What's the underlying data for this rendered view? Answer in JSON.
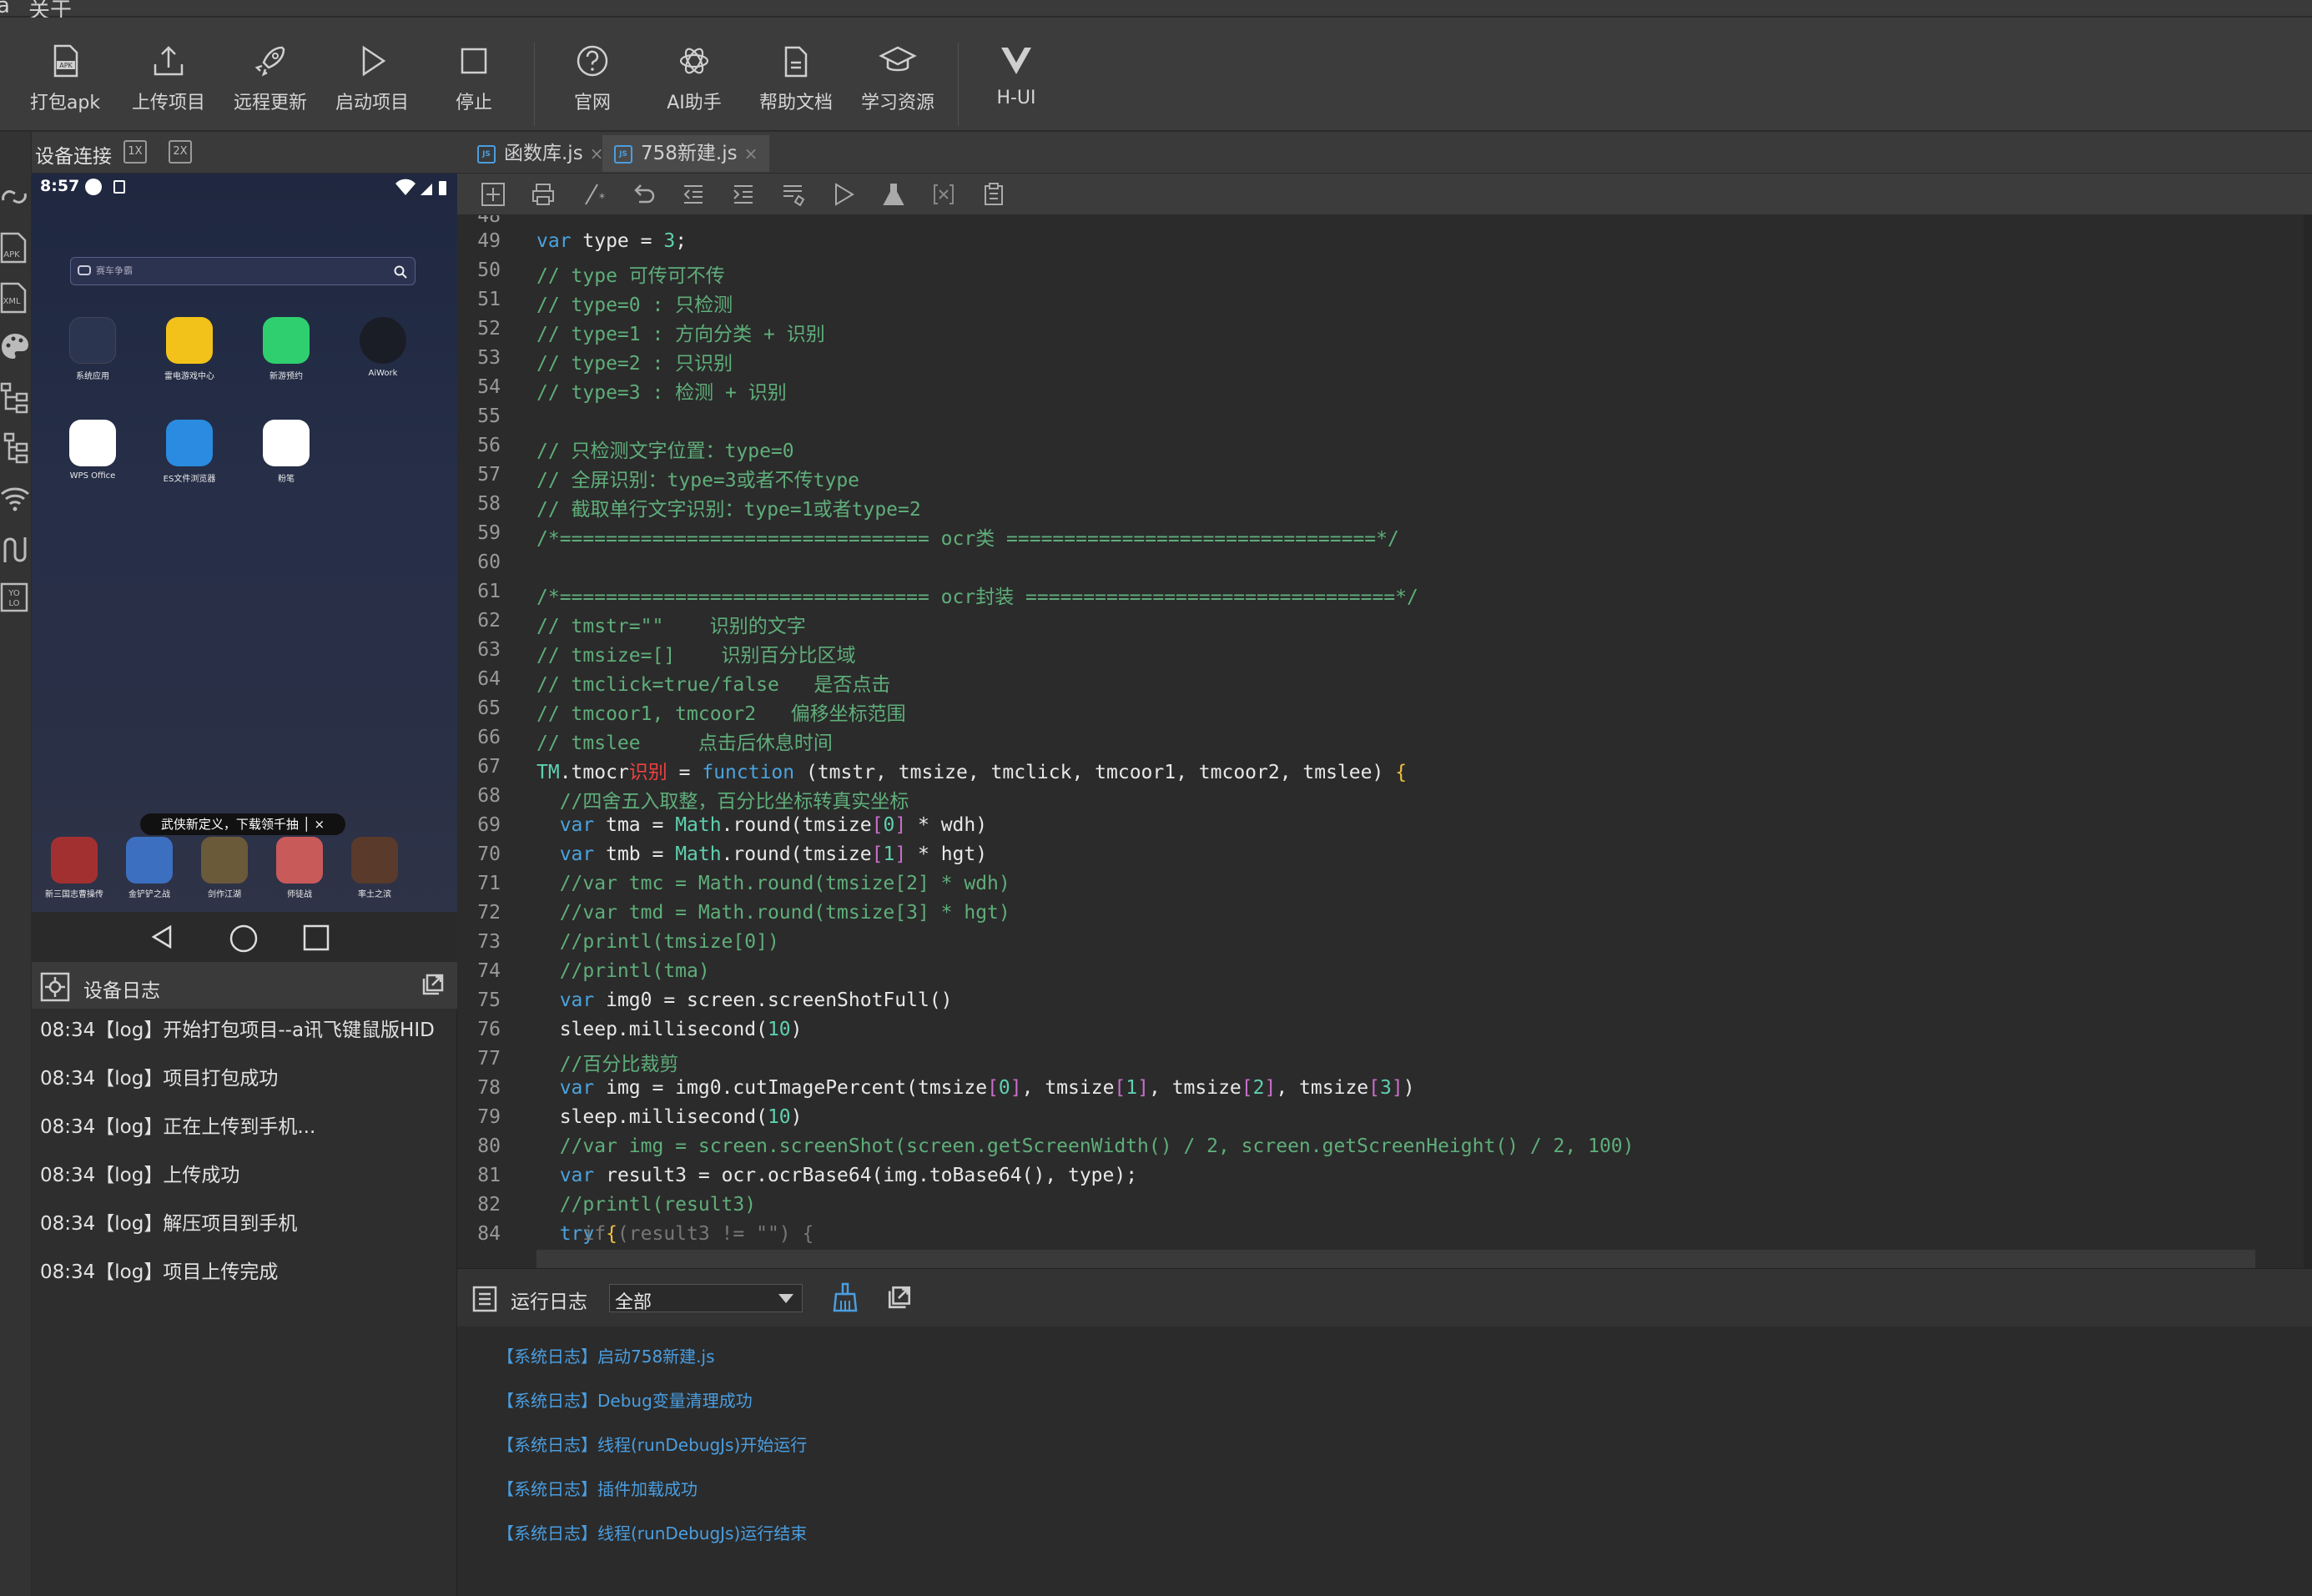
{
  "menubar": {
    "item0": "â",
    "item1": "关于"
  },
  "toolbar": [
    {
      "label": "打包apk",
      "icon": "apk-package-icon"
    },
    {
      "label": "上传项目",
      "icon": "upload-icon"
    },
    {
      "label": "远程更新",
      "icon": "rocket-icon"
    },
    {
      "label": "启动项目",
      "icon": "play-icon"
    },
    {
      "label": "停止",
      "icon": "stop-icon"
    },
    {
      "label": "官网",
      "icon": "help-circle-icon"
    },
    {
      "label": "AI助手",
      "icon": "ai-assistant-icon"
    },
    {
      "label": "帮助文档",
      "icon": "document-icon"
    },
    {
      "label": "学习资源",
      "icon": "graduation-cap-icon"
    },
    {
      "label": "H-UI",
      "icon": "h-ui-logo-icon"
    }
  ],
  "device_panel": {
    "title": "设备连接",
    "zoom1": "1X",
    "zoom2": "2X"
  },
  "phone": {
    "time": "8:57",
    "search_placeholder": "赛车争霸",
    "apps": [
      {
        "name": "系统应用",
        "color": "#2b3550"
      },
      {
        "name": "雷电游戏中心",
        "color": "#f2c21b"
      },
      {
        "name": "新游预约",
        "color": "#2fcf6f"
      },
      {
        "name": "AiWork",
        "color": "#1a1d26"
      },
      {
        "name": "WPS Office",
        "color": "#ffffff"
      },
      {
        "name": "ES文件浏览器",
        "color": "#2a8be0"
      },
      {
        "name": "粉笔",
        "color": "#ffffff"
      }
    ],
    "banner": "武侠新定义，下载领千抽 │ ×",
    "dock": [
      {
        "name": "新三国志曹操传",
        "color": "#a33030"
      },
      {
        "name": "金铲铲之战",
        "color": "#3c6fbf"
      },
      {
        "name": "剑作江湖",
        "color": "#6a5a3a"
      },
      {
        "name": "师徒战",
        "color": "#c85a5a"
      },
      {
        "name": "率土之滨",
        "color": "#5a3a2a"
      }
    ]
  },
  "device_log": {
    "title": "设备日志",
    "rows": [
      "08:34【log】开始打包项目--a讯飞键鼠版HID",
      "08:34【log】项目打包成功",
      "08:34【log】正在上传到手机...",
      "08:34【log】上传成功",
      "08:34【log】解压项目到手机",
      "08:34【log】项目上传完成"
    ]
  },
  "tabs": [
    {
      "label": "函数库.js"
    },
    {
      "label": "758新建.js"
    }
  ],
  "editor": {
    "first_partial_line": "48",
    "last_partial_line": "84",
    "lines": [
      {
        "n": "49",
        "text": "var type = 3;"
      },
      {
        "n": "50",
        "text": "// type 可传可不传"
      },
      {
        "n": "51",
        "text": "// type=0 : 只检测"
      },
      {
        "n": "52",
        "text": "// type=1 : 方向分类 + 识别"
      },
      {
        "n": "53",
        "text": "// type=2 : 只识别"
      },
      {
        "n": "54",
        "text": "// type=3 : 检测 + 识别"
      },
      {
        "n": "55",
        "text": ""
      },
      {
        "n": "56",
        "text": "// 只检测文字位置：type=0"
      },
      {
        "n": "57",
        "text": "// 全屏识别：type=3或者不传type"
      },
      {
        "n": "58",
        "text": "// 截取单行文字识别：type=1或者type=2"
      },
      {
        "n": "59",
        "text": "/*================================ ocr类 ================================*/"
      },
      {
        "n": "60",
        "text": ""
      },
      {
        "n": "61",
        "text": "/*================================ ocr封装 ================================*/"
      },
      {
        "n": "62",
        "text": "// tmstr=\"\"    识别的文字"
      },
      {
        "n": "63",
        "text": "// tmsize=[]    识别百分比区域"
      },
      {
        "n": "64",
        "text": "// tmclick=true/false   是否点击"
      },
      {
        "n": "65",
        "text": "// tmcoor1, tmcoor2   偏移坐标范围"
      },
      {
        "n": "66",
        "text": "// tmslee     点击后休息时间"
      },
      {
        "n": "67",
        "text": "TM.tmocr识别 = function (tmstr, tmsize, tmclick, tmcoor1, tmcoor2, tmslee) {"
      },
      {
        "n": "68",
        "text": "  //四舍五入取整，百分比坐标转真实坐标"
      },
      {
        "n": "69",
        "text": "  var tma = Math.round(tmsize[0] * wdh)"
      },
      {
        "n": "70",
        "text": "  var tmb = Math.round(tmsize[1] * hgt)"
      },
      {
        "n": "71",
        "text": "  //var tmc = Math.round(tmsize[2] * wdh)"
      },
      {
        "n": "72",
        "text": "  //var tmd = Math.round(tmsize[3] * hgt)"
      },
      {
        "n": "73",
        "text": "  //printl(tmsize[0])"
      },
      {
        "n": "74",
        "text": "  //printl(tma)"
      },
      {
        "n": "75",
        "text": "  var img0 = screen.screenShotFull()"
      },
      {
        "n": "76",
        "text": "  sleep.millisecond(10)"
      },
      {
        "n": "77",
        "text": "  //百分比裁剪"
      },
      {
        "n": "78",
        "text": "  var img = img0.cutImagePercent(tmsize[0], tmsize[1], tmsize[2], tmsize[3])"
      },
      {
        "n": "79",
        "text": "  sleep.millisecond(10)"
      },
      {
        "n": "80",
        "text": "  //var img = screen.screenShot(screen.getScreenWidth() / 2, screen.getScreenHeight() / 2, 100)"
      },
      {
        "n": "81",
        "text": "  var result3 = ocr.ocrBase64(img.toBase64(), type);"
      },
      {
        "n": "82",
        "text": "  //printl(result3)"
      },
      {
        "n": "83",
        "text": "  try {"
      }
    ],
    "partial_line_text": "    if (result3 != \"\") {"
  },
  "run_log": {
    "title": "运行日志",
    "filter_value": "全部",
    "rows": [
      "【系统日志】启动758新建.js",
      "【系统日志】Debug变量清理成功",
      "【系统日志】线程(runDebugJs)开始运行",
      "【系统日志】插件加载成功",
      "【系统日志】线程(runDebugJs)运行结束"
    ]
  },
  "colors": {
    "keyword": "#4aa3df",
    "comment": "#5fae7a",
    "accent_blue": "#4a9ee0"
  }
}
